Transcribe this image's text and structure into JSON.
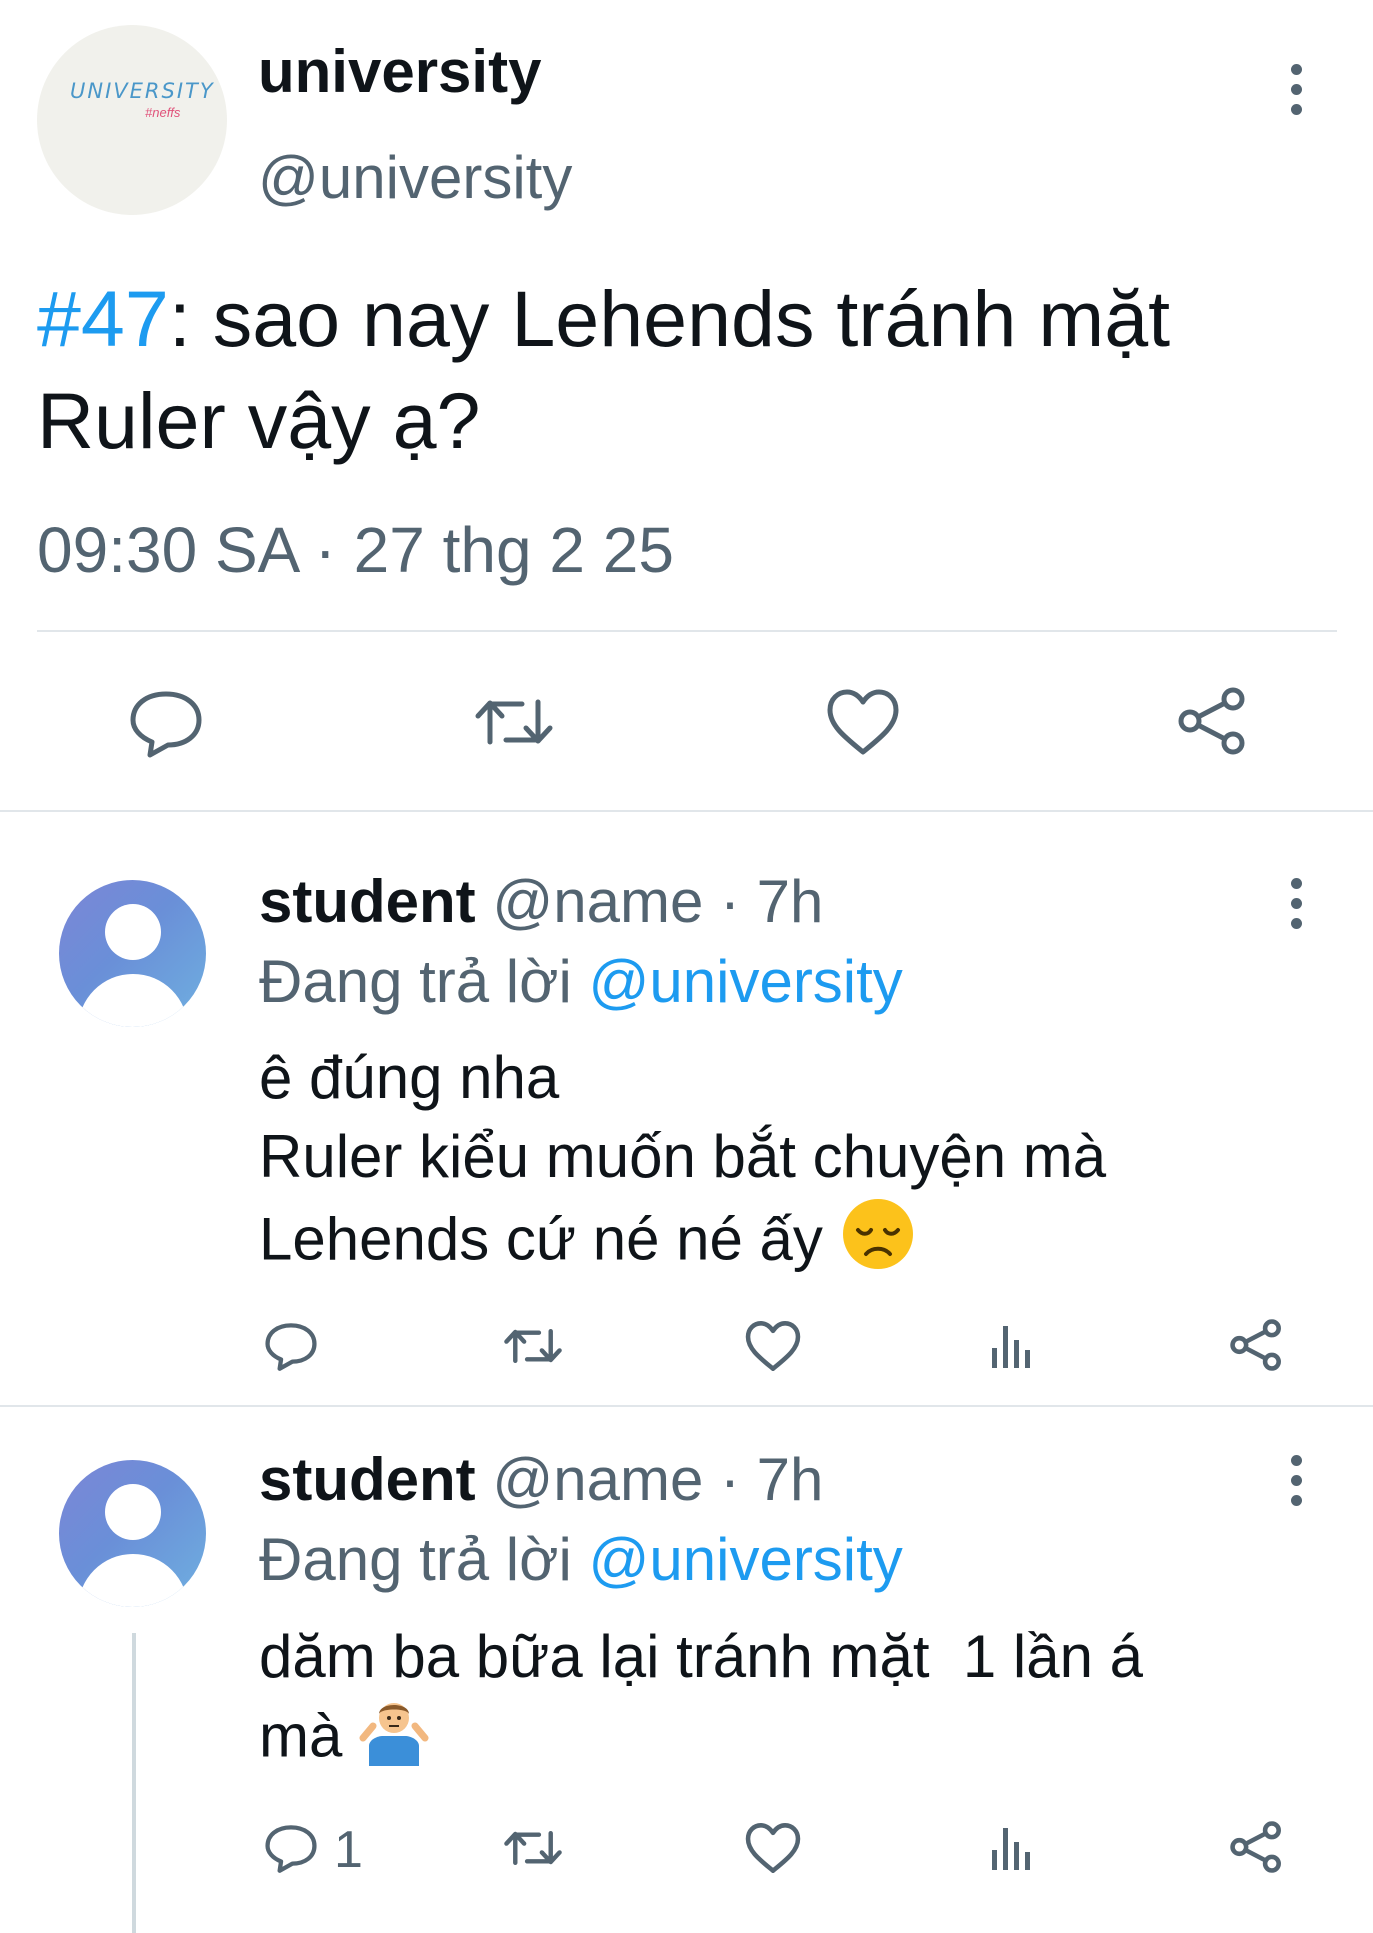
{
  "main_tweet": {
    "avatar_logo": "UNIVERSITY",
    "avatar_sub": "#neffs",
    "name": "university",
    "handle": "@university",
    "hashtag": "#47",
    "text_line1": ": sao nay Lehends tránh mặt",
    "text_line2": "Ruler vậy ạ?",
    "time": "09:30 SA",
    "separator": "·",
    "date": "27 thg 2 25",
    "actions": [
      "reply-icon",
      "retweet-icon",
      "like-icon",
      "share-icon"
    ]
  },
  "replies": [
    {
      "name": "student",
      "handle": "@name",
      "separator": "·",
      "age": "7h",
      "replying_prefix": "Đang trả lời",
      "replying_to": "@university",
      "lines": [
        "ê đúng nha",
        "Ruler kiểu muốn bắt chuyện mà",
        "Lehends cứ né né ấy"
      ],
      "emoji": "disappointed-face",
      "reply_count": "",
      "actions": [
        "reply-icon",
        "retweet-icon",
        "like-icon",
        "views-icon",
        "share-icon"
      ]
    },
    {
      "name": "student",
      "handle": "@name",
      "separator": "·",
      "age": "7h",
      "replying_prefix": "Đang trả lời",
      "replying_to": "@university",
      "lines": [
        "dăm ba bữa lại tránh mặt  1 lần á",
        "mà"
      ],
      "emoji": "person-shrugging",
      "reply_count": "1",
      "actions": [
        "reply-icon",
        "retweet-icon",
        "like-icon",
        "views-icon",
        "share-icon"
      ]
    }
  ],
  "colors": {
    "text": "#0f1419",
    "muted": "#536471",
    "link": "#1d9bf0",
    "divider": "#e1e6ea"
  }
}
